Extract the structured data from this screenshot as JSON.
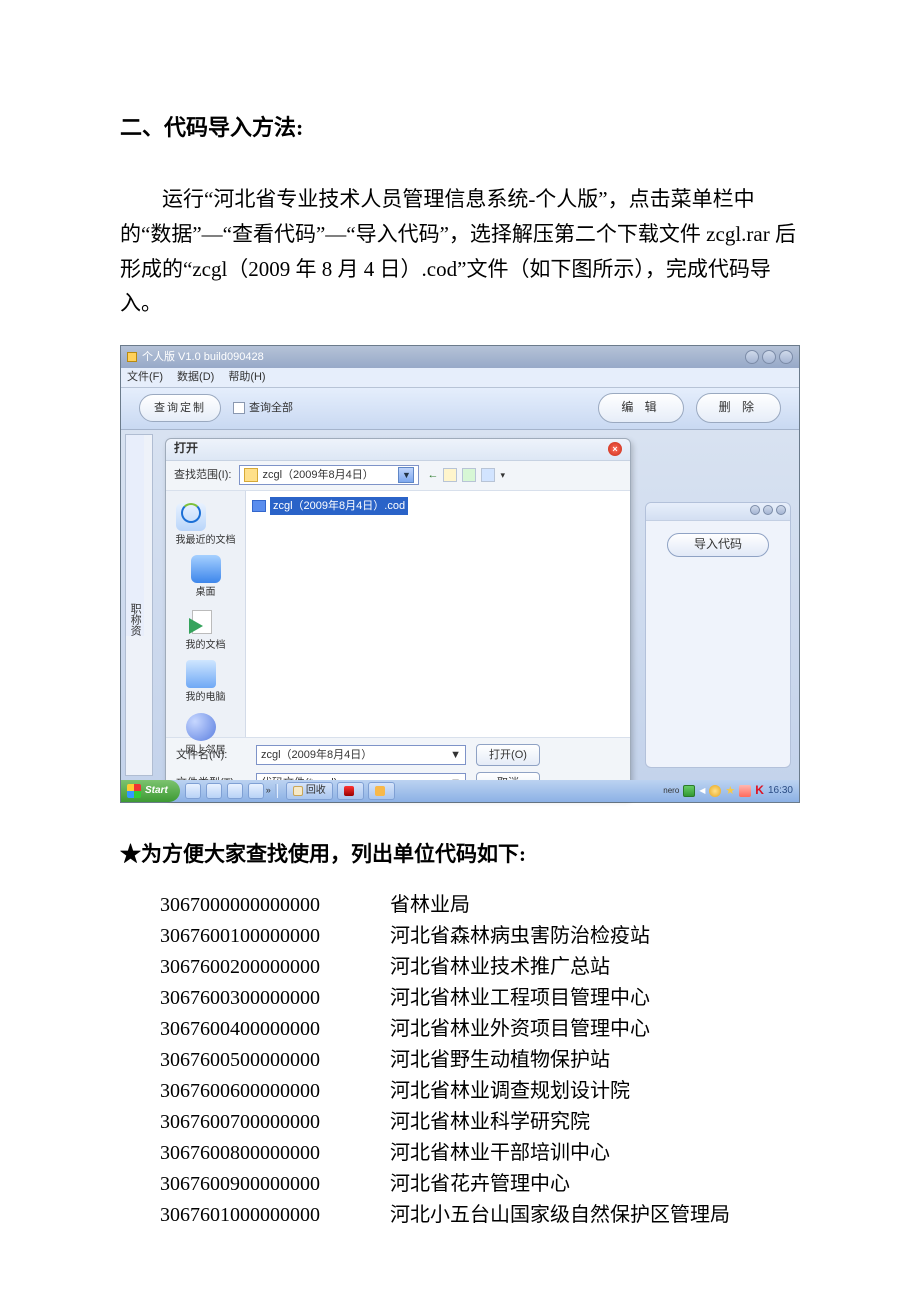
{
  "doc": {
    "heading": "二、代码导入方法:",
    "paragraph": "运行“河北省专业技术人员管理信息系统-个人版”，点击菜单栏中的“数据”—“查看代码”—“导入代码”，选择解压第二个下载文件 zcgl.rar 后形成的“zcgl（2009 年 8 月 4 日）.cod”文件（如下图所示），完成代码导入。",
    "subheading": "★为方便大家查找使用，列出单位代码如下:"
  },
  "app": {
    "title": "个人版 V1.0 build090428",
    "menus": {
      "file": "文件(F)",
      "data": "数据(D)",
      "help": "帮助(H)"
    },
    "toolbar": {
      "queryCustom": "查询定制",
      "queryAll": "查询全部",
      "edit": "编  辑",
      "delete": "删  除"
    },
    "leftTab": "职称资",
    "rightPanel": {
      "importCode": "导入代码"
    }
  },
  "dialog": {
    "title": "打开",
    "lookInLabel": "查找范围(I):",
    "lookInValue": "zcgl（2009年8月4日）",
    "places": {
      "recent": "我最近的文档",
      "desktop": "桌面",
      "mydocs": "我的文档",
      "mypc": "我的电脑",
      "network": "网上邻居"
    },
    "fileSelected": "zcgl（2009年8月4日）.cod",
    "fileNameLabel": "文件名(N):",
    "fileNameValue": "zcgl（2009年8月4日）",
    "fileTypeLabel": "文件类型(T):",
    "fileTypeValue": "代码文件(*.cod)",
    "open": "打开(O)",
    "cancel": "取消"
  },
  "taskbar": {
    "start": "Start",
    "btns": [
      "回收",
      "",
      ""
    ],
    "neroLabel": "nero",
    "clock": "16:30"
  },
  "units": [
    {
      "code": "3067000000000000",
      "name": "省林业局"
    },
    {
      "code": "3067600100000000",
      "name": "河北省森林病虫害防治检疫站"
    },
    {
      "code": "3067600200000000",
      "name": "河北省林业技术推广总站"
    },
    {
      "code": "3067600300000000",
      "name": "河北省林业工程项目管理中心"
    },
    {
      "code": "3067600400000000",
      "name": "河北省林业外资项目管理中心"
    },
    {
      "code": "3067600500000000",
      "name": "河北省野生动植物保护站"
    },
    {
      "code": "3067600600000000",
      "name": "河北省林业调查规划设计院"
    },
    {
      "code": "3067600700000000",
      "name": "河北省林业科学研究院"
    },
    {
      "code": "3067600800000000",
      "name": "河北省林业干部培训中心"
    },
    {
      "code": "3067600900000000",
      "name": "河北省花卉管理中心"
    },
    {
      "code": "3067601000000000",
      "name": "河北小五台山国家级自然保护区管理局"
    }
  ]
}
